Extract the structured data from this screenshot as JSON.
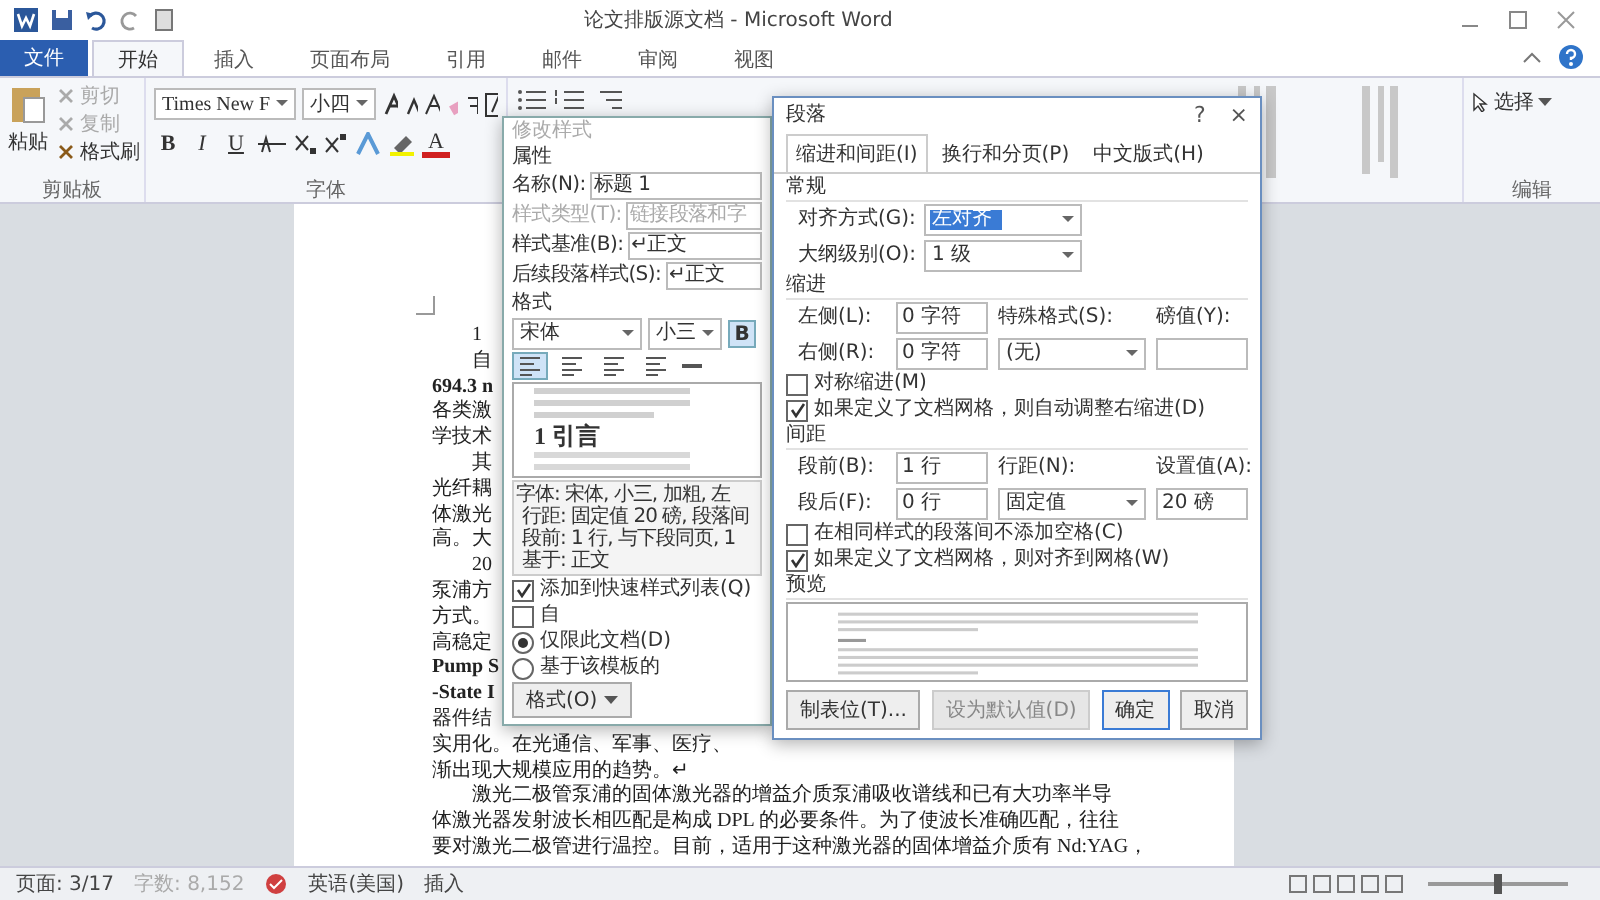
{
  "window": {
    "title": "论文排版源文档 - Microsoft Word"
  },
  "ribbon_tabs": [
    {
      "label": "文件",
      "kind": "file",
      "selected": false
    },
    {
      "label": "开始",
      "kind": "tab",
      "selected": true
    },
    {
      "label": "插入",
      "kind": "tab",
      "selected": false
    },
    {
      "label": "页面布局",
      "kind": "tab",
      "selected": false
    },
    {
      "label": "引用",
      "kind": "tab",
      "selected": false
    },
    {
      "label": "邮件",
      "kind": "tab",
      "selected": false
    },
    {
      "label": "审阅",
      "kind": "tab",
      "selected": false
    },
    {
      "label": "视图",
      "kind": "tab",
      "selected": false
    }
  ],
  "clipboard": {
    "paste": "粘贴",
    "label": "剪贴板",
    "items": [
      {
        "label": "剪切",
        "disabled": true
      },
      {
        "label": "复制",
        "disabled": true
      },
      {
        "label": "格式刷",
        "disabled": false
      }
    ]
  },
  "font": {
    "name": "Times New F",
    "size": "小四",
    "label": "字体",
    "buttons": [
      {
        "label": "B",
        "kind": "bold"
      },
      {
        "label": "I",
        "kind": "italic"
      },
      {
        "label": "U",
        "kind": "underline"
      }
    ],
    "color_button": "A"
  },
  "editing": {
    "select": "选择",
    "label": "编辑"
  },
  "document": {
    "lines": [
      {
        "text": "1",
        "indent": true,
        "bold": false
      },
      {
        "text": "自",
        "indent": true,
        "bold": false
      },
      {
        "text": "694.3 n",
        "indent": false,
        "bold": true
      },
      {
        "text": "各类激",
        "indent": false,
        "bold": false
      },
      {
        "text": "学技术",
        "indent": false,
        "bold": false
      },
      {
        "text": "其",
        "indent": true,
        "bold": false
      },
      {
        "text": "光纤耦",
        "indent": false,
        "bold": false
      },
      {
        "text": "体激光",
        "indent": false,
        "bold": false
      },
      {
        "text": "高。大",
        "indent": false,
        "bold": false
      },
      {
        "text": "20",
        "indent": true,
        "bold": false
      },
      {
        "text": "泵浦方",
        "indent": false,
        "bold": false
      },
      {
        "text": "方式。",
        "indent": false,
        "bold": false
      },
      {
        "text": "高稳定",
        "indent": false,
        "bold": false
      },
      {
        "text": "Pump S",
        "indent": false,
        "bold": true
      },
      {
        "text": "-State I",
        "indent": false,
        "bold": true
      },
      {
        "text": "器件结",
        "indent": false,
        "bold": false
      },
      {
        "text": "实用化。在光通信、军事、医疗、",
        "indent": false,
        "bold": false
      },
      {
        "text": "渐出现大规模应用的趋势。↵",
        "indent": false,
        "bold": false
      },
      {
        "text": "激光二极管泵浦的固体激光器的增益介质泵浦吸收谱线和已有大功率半导",
        "indent": true,
        "bold": false
      },
      {
        "text": "体激光器发射波长相匹配是构成 DPL 的必要条件。为了使波长准确匹配，往往",
        "indent": false,
        "bold": false
      },
      {
        "text": "要对激光二极管进行温控。目前，适用于这种激光器的固体增益介质有 Nd:YAG，",
        "indent": false,
        "bold": false
      }
    ]
  },
  "modify_style": {
    "title": "修改样式",
    "properties_heading": "属性",
    "fields": [
      {
        "label": "名称(N):",
        "value": "标题 1",
        "disabled": false
      },
      {
        "label": "样式类型(T):",
        "value": "链接段落和字",
        "disabled": true
      },
      {
        "label": "样式基准(B):",
        "value": "↵正文",
        "disabled": false
      },
      {
        "label": "后续段落样式(S):",
        "value": "↵正文",
        "disabled": false
      }
    ],
    "format_heading": "格式",
    "font": "宋体",
    "size": "小三",
    "bold_button": {
      "label": "B",
      "selected": true
    },
    "align_buttons": [
      {
        "selected": true
      },
      {
        "selected": false
      },
      {
        "selected": false
      },
      {
        "selected": false
      }
    ],
    "preview_text": "1 引言",
    "description": [
      "字体: 宋体, 小三, 加粗, 左",
      "行距: 固定值 20 磅, 段落间",
      "段前: 1 行, 与下段同页, 1",
      "基于: 正文"
    ],
    "checks": [
      {
        "label": "添加到快速样式列表(Q)",
        "checked": true
      },
      {
        "label": "自",
        "checked": false
      }
    ],
    "radios": [
      {
        "label": "仅限此文档(D)",
        "selected": true
      },
      {
        "label": "基于该模板的",
        "selected": false
      }
    ],
    "format_menu": "格式(O)"
  },
  "paragraph_dialog": {
    "title": "段落",
    "help": "?",
    "close": "×",
    "tabs": [
      {
        "label": "缩进和间距(I)",
        "selected": true
      },
      {
        "label": "换行和分页(P)",
        "selected": false
      },
      {
        "label": "中文版式(H)",
        "selected": false
      }
    ],
    "general": {
      "heading": "常规",
      "alignment_label": "对齐方式(G):",
      "alignment": "左对齐",
      "outline_label": "大纲级别(O):",
      "outline": "1 级"
    },
    "indent": {
      "heading": "缩进",
      "left_label": "左侧(L):",
      "left": "0 字符",
      "right_label": "右侧(R):",
      "right": "0 字符",
      "special_label": "特殊格式(S):",
      "special": "(无)",
      "by_label": "磅值(Y):"
    },
    "indent_checks": [
      {
        "label": "对称缩进(M)",
        "checked": false
      },
      {
        "label": "如果定义了文档网格，则自动调整右缩进(D)",
        "checked": true
      }
    ],
    "spacing": {
      "heading": "间距",
      "before_label": "段前(B):",
      "before": "1 行",
      "after_label": "段后(F):",
      "after": "0 行",
      "line_label": "行距(N):",
      "line": "固定值",
      "at_label": "设置值(A):",
      "at": "20 磅"
    },
    "spacing_checks": [
      {
        "label": "在相同样式的段落间不添加空格(C)",
        "checked": false
      },
      {
        "label": "如果定义了文档网格，则对齐到网格(W)",
        "checked": true
      }
    ],
    "preview_heading": "预览",
    "buttons": [
      {
        "label": "制表位(T)...",
        "disabled": false,
        "default": false
      },
      {
        "label": "设为默认值(D)",
        "disabled": true,
        "default": false
      },
      {
        "label": "确定",
        "disabled": false,
        "default": true
      },
      {
        "label": "取消",
        "disabled": false,
        "default": false
      }
    ]
  },
  "status_bar": {
    "items": [
      {
        "text": "页面: 3/17",
        "disabled": false
      },
      {
        "text": "字数: 8,152",
        "disabled": true
      },
      {
        "text": "英语(美国)",
        "disabled": false
      },
      {
        "text": "插入",
        "disabled": false
      }
    ],
    "zoom": {
      "level": 0.5
    }
  }
}
